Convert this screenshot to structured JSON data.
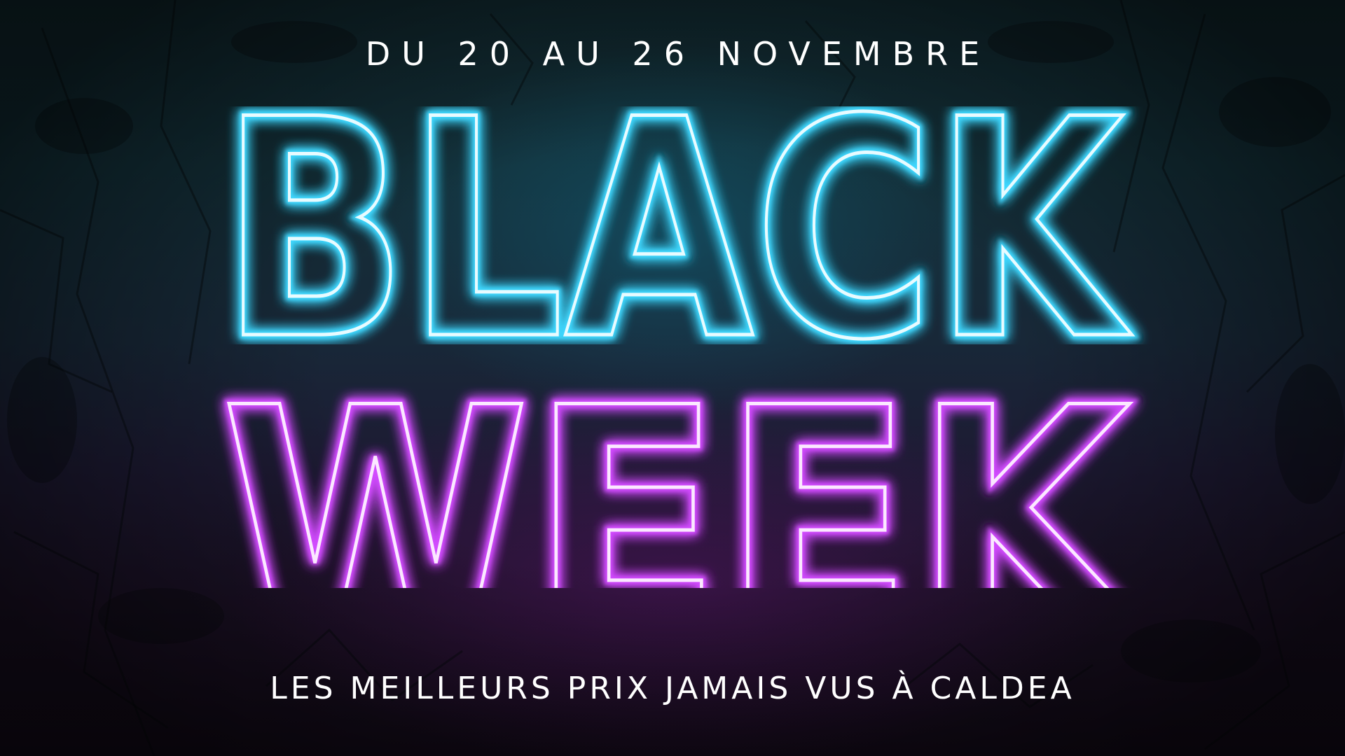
{
  "banner": {
    "dates": "DU 20 AU 26 NOVEMBRE",
    "headline_line1": "BLACK",
    "headline_line2": "WEEK",
    "tagline": "LES MEILLEURS PRIX JAMAIS VUS À CALDEA"
  },
  "colors": {
    "neon_cyan": "#3fd8ff",
    "neon_cyan_core": "#e8fbff",
    "neon_magenta": "#d24cff",
    "neon_magenta_core": "#fbe8ff",
    "text": "#ffffff"
  }
}
